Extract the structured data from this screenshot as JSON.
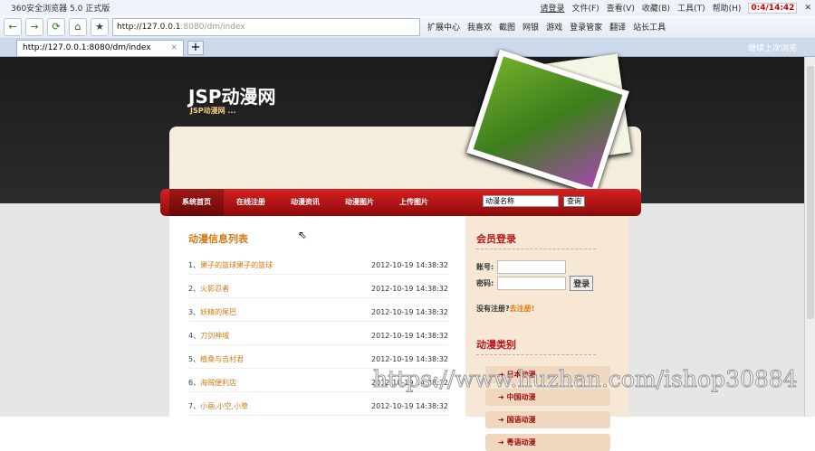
{
  "browser": {
    "title": "360安全浏览器 5.0 正式版",
    "login": "请登录",
    "menus": [
      "文件(F)",
      "查看(V)",
      "收藏(B)",
      "工具(T)",
      "帮助(H)"
    ],
    "clock": "0:4/14:42",
    "url_host": "http://127.0.0.1",
    "url_rest": ":8080/dm/index",
    "toolbar_items": [
      "扩展中心",
      "我喜欢",
      "截图",
      "网银",
      "游戏",
      "登录管家",
      "翻译",
      "站长工具"
    ],
    "tab_label": "http://127.0.0.1:8080/dm/index",
    "tab_right": "继续上次浏览"
  },
  "site": {
    "logo": "JSP动漫网",
    "slogan": "JSP动漫网 ...",
    "nav": [
      "系统首页",
      "在线注册",
      "动漫资讯",
      "动漫图片",
      "上传图片"
    ],
    "search_value": "动漫名称",
    "search_button": "查询"
  },
  "list": {
    "title": "动漫信息列表",
    "items": [
      {
        "n": "1、",
        "t": "果子的篮球果子的篮球",
        "d": "2012-10-19 14:38:32"
      },
      {
        "n": "2、",
        "t": "火影忍者",
        "d": "2012-10-19 14:38:32"
      },
      {
        "n": "3、",
        "t": "妖精的尾巴",
        "d": "2012-10-19 14:38:32"
      },
      {
        "n": "4、",
        "t": "刀剑神域",
        "d": "2012-10-19 14:38:32"
      },
      {
        "n": "5、",
        "t": "植桑与吉村君",
        "d": "2012-10-19 14:38:32"
      },
      {
        "n": "6、",
        "t": "海贼便利店",
        "d": "2012-10-19 14:38:32"
      },
      {
        "n": "7、",
        "t": "小画,小空,小草",
        "d": "2012-10-19 14:38:32"
      }
    ]
  },
  "login": {
    "title": "会员登录",
    "account": "账号:",
    "password": "密码:",
    "button": "登录",
    "no_reg": "没有注册?",
    "reg_link": "去注册!"
  },
  "categories": {
    "title": "动漫类别",
    "items": [
      "日本动漫",
      "中国动漫",
      "国语动漫",
      "粤语动漫"
    ]
  },
  "watermark": "https://www.huzhan.com/ishop30884"
}
